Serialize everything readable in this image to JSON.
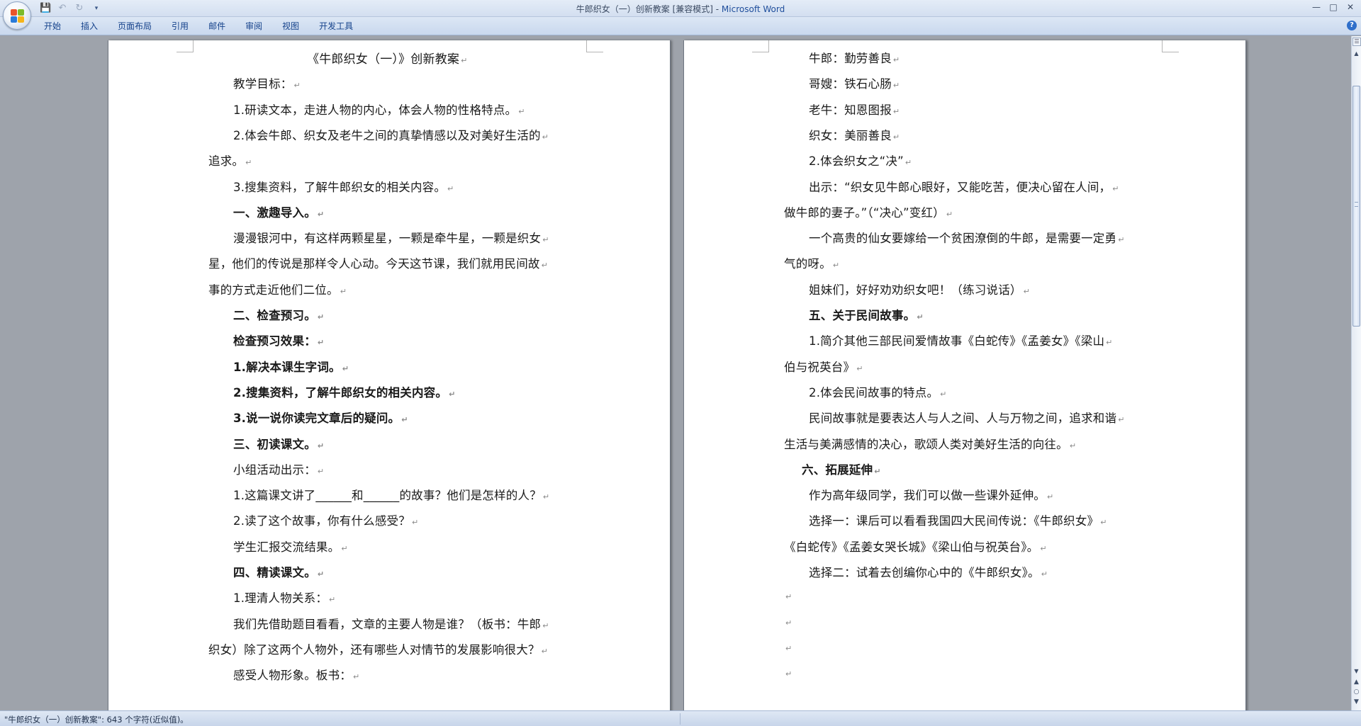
{
  "window": {
    "doc_title": "牛郎织女（一）创新教案 [兼容模式] - ",
    "app_name": "Microsoft Word"
  },
  "colors": {
    "ribbon_text": "#15428b",
    "workspace_bg": "#9ea3ab",
    "title_app": "#1f4e9c"
  },
  "quick_access": {
    "save_icon": "save-icon",
    "undo_icon": "undo-icon",
    "redo_icon": "redo-icon",
    "customize_icon": "customize-icon"
  },
  "ribbon": {
    "tabs": [
      "开始",
      "插入",
      "页面布局",
      "引用",
      "邮件",
      "审阅",
      "视图",
      "开发工具"
    ]
  },
  "left_page": {
    "lines": [
      {
        "text": "《牛郎织女（一）》创新教案",
        "style": "title"
      },
      {
        "text": "教学目标：",
        "style": "indent"
      },
      {
        "text": "1.研读文本，走进人物的内心，体会人物的性格特点。",
        "style": "indent"
      },
      {
        "text": "2.体会牛郎、织女及老牛之间的真挚情感以及对美好生活的",
        "style": "indent"
      },
      {
        "text": "追求。",
        "style": "cont"
      },
      {
        "text": "3.搜集资料，了解牛郎织女的相关内容。",
        "style": "indent"
      },
      {
        "text": "一、激趣导入。",
        "style": "indent-bold"
      },
      {
        "text": "漫漫银河中，有这样两颗星星，一颗是牵牛星，一颗是织女",
        "style": "indent"
      },
      {
        "text": "星，他们的传说是那样令人心动。今天这节课，我们就用民间故",
        "style": "cont"
      },
      {
        "text": "事的方式走近他们二位。",
        "style": "cont"
      },
      {
        "text": "二、检查预习。",
        "style": "indent-bold"
      },
      {
        "text": "检查预习效果：",
        "style": "indent-bold"
      },
      {
        "text": "1.解决本课生字词。",
        "style": "indent-bold"
      },
      {
        "text": "2.搜集资料，了解牛郎织女的相关内容。",
        "style": "indent-bold"
      },
      {
        "text": "3.说一说你读完文章后的疑问。",
        "style": "indent-bold"
      },
      {
        "text": "三、初读课文。",
        "style": "indent-bold"
      },
      {
        "text": "小组活动出示：",
        "style": "indent"
      },
      {
        "text": "1.这篇课文讲了______和______的故事？他们是怎样的人？",
        "style": "indent"
      },
      {
        "text": "2.读了这个故事，你有什么感受？",
        "style": "indent"
      },
      {
        "text": "学生汇报交流结果。",
        "style": "indent"
      },
      {
        "text": "四、精读课文。",
        "style": "indent-bold"
      },
      {
        "text": "1.理清人物关系：",
        "style": "indent"
      },
      {
        "text": "我们先借助题目看看，文章的主要人物是谁？（板书：牛郎",
        "style": "indent"
      },
      {
        "text": "织女）除了这两个人物外，还有哪些人对情节的发展影响很大？",
        "style": "cont"
      },
      {
        "text": "感受人物形象。板书：",
        "style": "indent"
      }
    ]
  },
  "right_page": {
    "lines": [
      {
        "text": "牛郎：勤劳善良",
        "style": "indent"
      },
      {
        "text": "哥嫂：铁石心肠",
        "style": "indent"
      },
      {
        "text": "老牛：知恩图报",
        "style": "indent"
      },
      {
        "text": "织女：美丽善良",
        "style": "indent"
      },
      {
        "text": "2.体会织女之“决”",
        "style": "indent"
      },
      {
        "text": "出示：“织女见牛郎心眼好，又能吃苦，便决心留在人间，",
        "style": "indent"
      },
      {
        "text": "做牛郎的妻子。”（“决心”变红）",
        "style": "cont"
      },
      {
        "text": "一个高贵的仙女要嫁给一个贫困潦倒的牛郎，是需要一定勇",
        "style": "indent"
      },
      {
        "text": "气的呀。",
        "style": "cont"
      },
      {
        "text": "姐妹们，好好劝劝织女吧！（练习说话）",
        "style": "indent"
      },
      {
        "text": "五、关于民间故事。",
        "style": "indent-bold"
      },
      {
        "text": "1.简介其他三部民间爱情故事《白蛇传》《孟姜女》《梁山",
        "style": "indent"
      },
      {
        "text": "伯与祝英台》",
        "style": "cont"
      },
      {
        "text": "2.体会民间故事的特点。",
        "style": "indent"
      },
      {
        "text": "民间故事就是要表达人与人之间、人与万物之间，追求和谐",
        "style": "indent"
      },
      {
        "text": "生活与美满感情的决心，歌颂人类对美好生活的向往。",
        "style": "cont"
      },
      {
        "text": "六、拓展延伸",
        "style": "indent-bold-small"
      },
      {
        "text": "作为高年级同学，我们可以做一些课外延伸。",
        "style": "indent"
      },
      {
        "text": "选择一：课后可以看看我国四大民间传说：《牛郎织女》",
        "style": "indent"
      },
      {
        "text": "《白蛇传》《孟姜女哭长城》《梁山伯与祝英台》。",
        "style": "cont"
      },
      {
        "text": "选择二：试着去创编你心中的《牛郎织女》。",
        "style": "indent"
      },
      {
        "text": "",
        "style": "cont"
      },
      {
        "text": "",
        "style": "cont"
      },
      {
        "text": "",
        "style": "cont"
      },
      {
        "text": "",
        "style": "cont"
      }
    ]
  },
  "paragraph_mark": "↵",
  "status": {
    "text": "\"牛郎织女（一）创新教案\": 643 个字符(近似值)。"
  },
  "icons": {
    "office_button": "office-logo-icon",
    "help": "help-icon",
    "minimize": "minimize-icon",
    "maximize": "maximize-icon",
    "close": "close-icon"
  }
}
